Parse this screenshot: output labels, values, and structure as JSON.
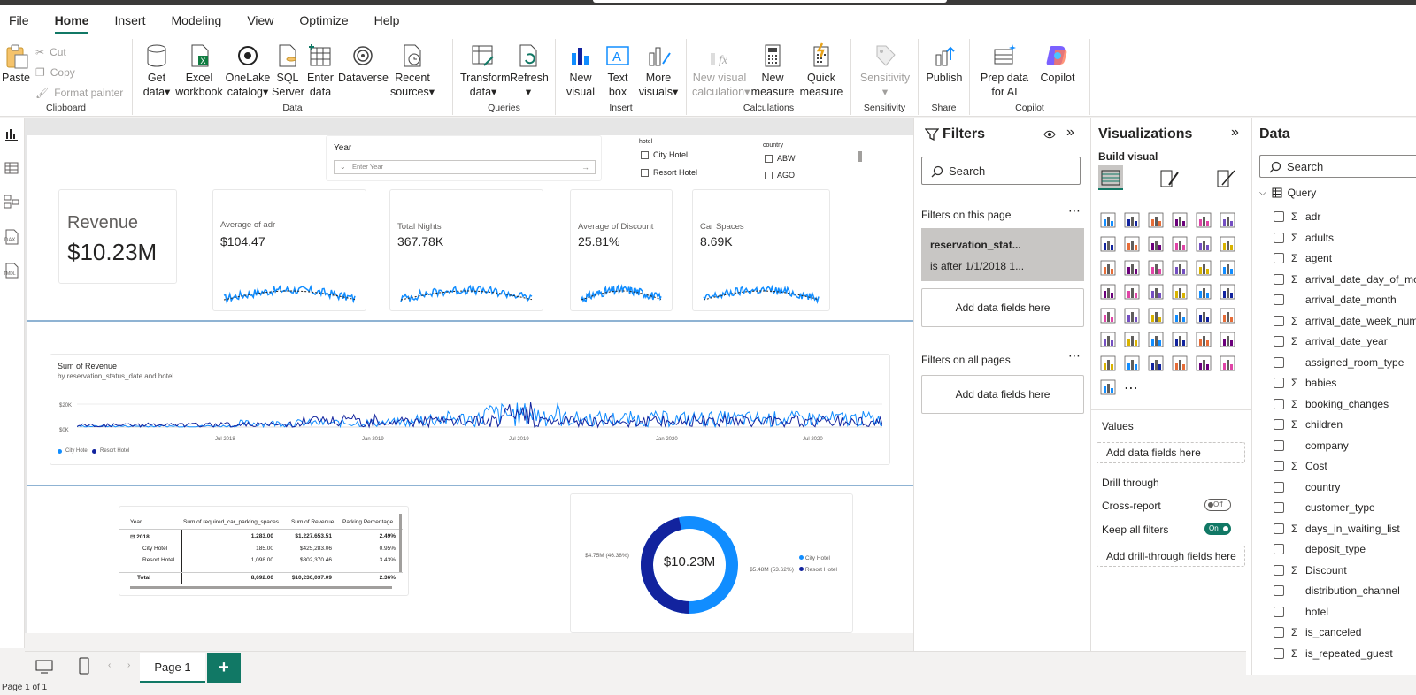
{
  "menu": [
    "File",
    "Home",
    "Insert",
    "Modeling",
    "View",
    "Optimize",
    "Help"
  ],
  "menu_active": "Home",
  "ribbon": {
    "clipboard": {
      "paste": "Paste",
      "cut": "Cut",
      "copy": "Copy",
      "format_painter": "Format painter",
      "group": "Clipboard"
    },
    "data": {
      "get_data": "Get data",
      "excel": "Excel workbook",
      "onelake": "OneLake catalog",
      "sql": "SQL Server",
      "enter": "Enter data",
      "dataverse": "Dataverse",
      "recent": "Recent sources",
      "group": "Data"
    },
    "queries": {
      "transform": "Transform data",
      "refresh": "Refresh",
      "group": "Queries"
    },
    "insert": {
      "new_visual": "New visual",
      "text_box": "Text box",
      "more_visuals": "More visuals",
      "group": "Insert"
    },
    "calculations": {
      "new_visual_calc": "New visual calculation",
      "new_measure": "New measure",
      "quick_measure": "Quick measure",
      "group": "Calculations"
    },
    "sensitivity": {
      "sensitivity": "Sensitivity",
      "group": "Sensitivity"
    },
    "share": {
      "publish": "Publish",
      "group": "Share"
    },
    "copilot": {
      "prep": "Prep data for AI",
      "copilot": "Copilot",
      "group": "Copilot"
    }
  },
  "canvas": {
    "year_slicer": {
      "title": "Year",
      "placeholder": "Enter Year"
    },
    "hotel_slicer": {
      "title": "hotel",
      "options": [
        "City Hotel",
        "Resort Hotel"
      ]
    },
    "country_slicer": {
      "title": "country",
      "options": [
        "ABW",
        "AGO"
      ]
    },
    "revenue_card": {
      "label": "Revenue",
      "value": "$10.23M"
    },
    "kpis": [
      {
        "label": "Average of adr",
        "value": "$104.47"
      },
      {
        "label": "Total Nights",
        "value": "367.78K"
      },
      {
        "label": "Average of Discount",
        "value": "25.81%"
      },
      {
        "label": "Car Spaces",
        "value": "8.69K"
      }
    ],
    "line_chart": {
      "title": "Sum of Revenue",
      "subtitle": "by reservation_status_date and hotel",
      "y_ticks": [
        "$20K",
        "$0K"
      ],
      "x_ticks": [
        "Jul 2018",
        "Jan 2019",
        "Jul 2019",
        "Jan 2020",
        "Jul 2020"
      ],
      "legend": [
        "City Hotel",
        "Resort Hotel"
      ]
    },
    "table": {
      "headers": [
        "Year",
        "Sum of required_car_parking_spaces",
        "Sum of Revenue",
        "Parking Percentage"
      ],
      "rows": [
        {
          "year": "2018",
          "spaces": "1,283.00",
          "revenue": "$1,227,653.51",
          "pct": "2.49%"
        },
        {
          "year": "City Hotel",
          "spaces": "185.00",
          "revenue": "$425,283.06",
          "pct": "0.95%"
        },
        {
          "year": "Resort Hotel",
          "spaces": "1,098.00",
          "revenue": "$802,370.46",
          "pct": "3.43%"
        }
      ],
      "total": {
        "label": "Total",
        "spaces": "8,692.00",
        "revenue": "$10,230,037.09",
        "pct": "2.36%"
      }
    },
    "donut": {
      "center": "$10.23M",
      "left_label": "$4.75M (46.38%)",
      "right_label": "$5.48M (53.62%)",
      "legend": [
        "City Hotel",
        "Resort Hotel"
      ]
    }
  },
  "filters": {
    "title": "Filters",
    "search": "Search",
    "on_page": "Filters on this page",
    "filter_card": {
      "field": "reservation_stat...",
      "condition": "is after 1/1/2018 1..."
    },
    "add": "Add data fields here",
    "on_all": "Filters on all pages",
    "add2": "Add data fields here"
  },
  "viz": {
    "title": "Visualizations",
    "build": "Build visual",
    "values": "Values",
    "add_values": "Add data fields here",
    "drill": "Drill through",
    "cross_report": "Cross-report",
    "cross_state": "Off",
    "keep_filters": "Keep all filters",
    "keep_state": "On",
    "add_drill": "Add drill-through fields here"
  },
  "data": {
    "title": "Data",
    "search": "Search",
    "table": "Query",
    "fields": [
      {
        "name": "adr",
        "sigma": true
      },
      {
        "name": "adults",
        "sigma": true
      },
      {
        "name": "agent",
        "sigma": true
      },
      {
        "name": "arrival_date_day_of_month",
        "sigma": true
      },
      {
        "name": "arrival_date_month",
        "sigma": false
      },
      {
        "name": "arrival_date_week_number",
        "sigma": true
      },
      {
        "name": "arrival_date_year",
        "sigma": true
      },
      {
        "name": "assigned_room_type",
        "sigma": false
      },
      {
        "name": "babies",
        "sigma": true
      },
      {
        "name": "booking_changes",
        "sigma": true
      },
      {
        "name": "children",
        "sigma": true
      },
      {
        "name": "company",
        "sigma": false
      },
      {
        "name": "Cost",
        "sigma": true
      },
      {
        "name": "country",
        "sigma": false
      },
      {
        "name": "customer_type",
        "sigma": false
      },
      {
        "name": "days_in_waiting_list",
        "sigma": true
      },
      {
        "name": "deposit_type",
        "sigma": false
      },
      {
        "name": "Discount",
        "sigma": true
      },
      {
        "name": "distribution_channel",
        "sigma": false
      },
      {
        "name": "hotel",
        "sigma": false
      },
      {
        "name": "is_canceled",
        "sigma": true
      },
      {
        "name": "is_repeated_guest",
        "sigma": true
      }
    ]
  },
  "pages": {
    "current": "Page 1"
  },
  "status": "Page 1 of 1",
  "colors": {
    "accent": "#117865",
    "city": "#118dff",
    "resort": "#12239e"
  }
}
